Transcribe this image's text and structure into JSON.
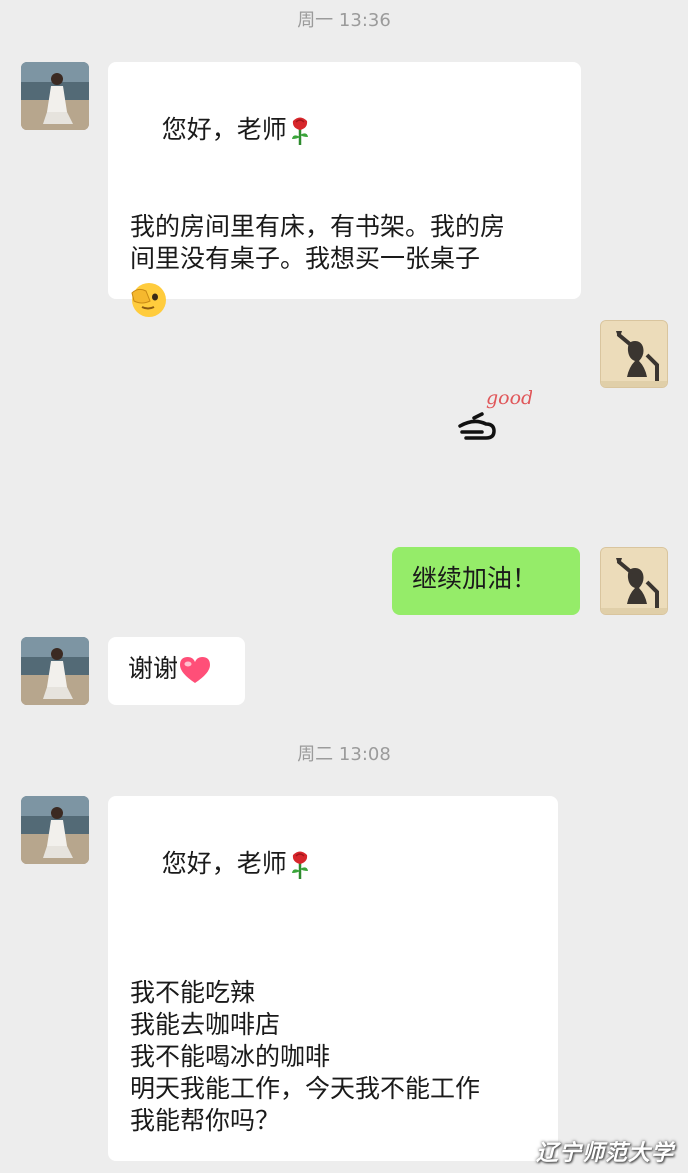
{
  "timestamps": [
    "周一 13:36",
    "周二 13:08"
  ],
  "messages": {
    "m1": {
      "sender": "student",
      "lines": [
        "您好，老师",
        "",
        "我的房间里有床，有书架。我的房",
        "间里没有桌子。我想买一张桌子"
      ],
      "emoji_after_line1": "rose-emoji",
      "trailing_emoji": "cover-eye-emoji"
    },
    "m2": {
      "sender": "teacher",
      "type": "sticker",
      "sticker_text": "good",
      "icon": "thumbs-up-hand-sticker"
    },
    "m3": {
      "sender": "teacher",
      "text": "继续加油！"
    },
    "m4": {
      "sender": "student",
      "text": "谢谢",
      "trailing_emoji": "heart-emoji"
    },
    "m5": {
      "sender": "student",
      "lines": [
        "您好，老师",
        "",
        "我不能吃辣",
        "我能去咖啡店",
        "我不能喝冰的咖啡",
        "明天我能工作，今天我不能工作",
        "我能帮你吗？"
      ],
      "emoji_after_line1": "rose-emoji"
    }
  },
  "watermark": "辽宁师范大学",
  "colors": {
    "background": "#ededed",
    "incoming_bubble": "#ffffff",
    "outgoing_bubble": "#95ec69",
    "timestamp": "#9b9b9b"
  }
}
